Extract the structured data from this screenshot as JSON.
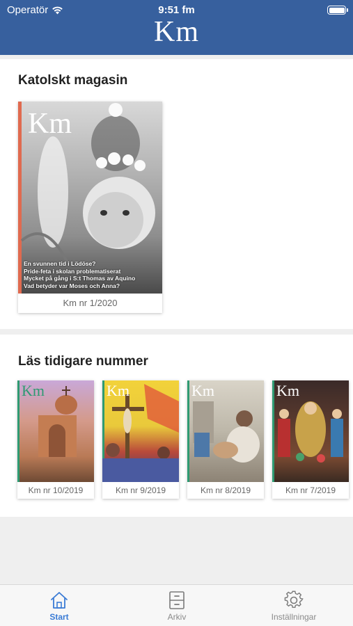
{
  "status_bar": {
    "carrier": "Operatör",
    "time": "9:51 fm"
  },
  "header": {
    "logo": "Km"
  },
  "current_section": {
    "title": "Katolskt magasin",
    "issue": {
      "label": "Km nr 1/2020",
      "cover_masthead": "Km",
      "cover_headlines": [
        "En svunnen tid i Lödöse?",
        "Pride-feta i skolan problematiserat",
        "Mycket på gång i S:t Thomas av Aquino",
        "Vad betyder var Moses och Anna?"
      ]
    }
  },
  "archive_section": {
    "title": "Läs tidigare nummer",
    "issues": [
      {
        "label": "Km nr 10/2019",
        "cover_masthead": "Km"
      },
      {
        "label": "Km nr 9/2019",
        "cover_masthead": "Km"
      },
      {
        "label": "Km nr 8/2019",
        "cover_masthead": "Km"
      },
      {
        "label": "Km nr 7/2019",
        "cover_masthead": "Km"
      }
    ]
  },
  "tabbar": {
    "tabs": [
      {
        "label": "Start",
        "icon": "home-icon",
        "active": true
      },
      {
        "label": "Arkiv",
        "icon": "archive-cabinet-icon",
        "active": false
      },
      {
        "label": "Inställningar",
        "icon": "gear-icon",
        "active": false
      }
    ],
    "colors": {
      "active": "#3a7bd5",
      "inactive": "#8a8a8a"
    }
  },
  "colors": {
    "header_bg": "#37609e",
    "background": "#efefef"
  }
}
